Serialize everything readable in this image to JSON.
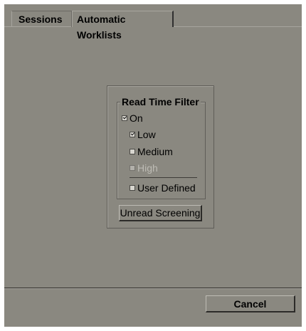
{
  "tabs": [
    {
      "label": "Sessions",
      "active": false
    },
    {
      "label": "Automatic Worklists",
      "active": true
    }
  ],
  "read_time_filter": {
    "title": "Read Time Filter",
    "on": {
      "label": "On",
      "checked": true,
      "enabled": true
    },
    "low": {
      "label": "Low",
      "checked": true,
      "enabled": true
    },
    "medium": {
      "label": "Medium",
      "checked": false,
      "enabled": true
    },
    "high": {
      "label": "High",
      "checked": false,
      "enabled": false
    },
    "user_defined": {
      "label": "User Defined",
      "checked": false,
      "enabled": true
    }
  },
  "buttons": {
    "unread_screening": "Unread Screening",
    "cancel": "Cancel"
  },
  "colors": {
    "background": "#8a8880",
    "disabled_text": "#bebcb5",
    "shadow": "#2c2b29",
    "highlight": "#bebcb5"
  },
  "icons": {
    "checked": "checkbox-checked-icon",
    "unchecked": "checkbox-unchecked-icon"
  }
}
